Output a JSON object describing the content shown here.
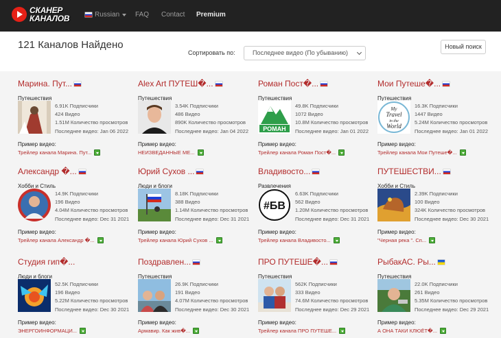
{
  "nav": {
    "logo_line1": "СКАНЕР",
    "logo_line2": "КАНАЛОВ",
    "language": "Russian",
    "faq": "FAQ",
    "contact": "Contact",
    "premium": "Premium"
  },
  "heading": "121 Каналов Найдено",
  "sort": {
    "label": "Сортировать по:",
    "value": "Последнее видео (По убыванию)"
  },
  "new_search": "Новый поиск",
  "example_label": "Пример видео:",
  "channels": [
    {
      "title": "Марина. Пут...",
      "flag": "ru",
      "category": "Путешествия",
      "subscribers": "6.91K Подписчики",
      "videos": "424 Видео",
      "views": "1.51M Количество просмотров",
      "last_video": "Последнее видео: Jan 06 2022",
      "example": "Трейлер канала Марина. Пут..."
    },
    {
      "title": "Alex Art ПУТЕШ�...",
      "flag": "ru",
      "category": "Путешествия",
      "subscribers": "3.54K Подписчики",
      "videos": "486 Видео",
      "views": "890K Количество просмотров",
      "last_video": "Последнее видео: Jan 04 2022",
      "example": "НЕИЗВЕДАННЫЕ МЕ..."
    },
    {
      "title": "Роман Пост�...",
      "flag": "ru",
      "category": "Путешествия",
      "subscribers": "49.8K Подписчики",
      "videos": "1072 Видео",
      "views": "10.8M Количество просмотров",
      "last_video": "Последнее видео: Jan 01 2022",
      "example": "Трейлер канала Роман Пост�..."
    },
    {
      "title": "Мои Путеше�...",
      "flag": "ru",
      "category": "Путешествия",
      "subscribers": "16.3K Подписчики",
      "videos": "1447 Видео",
      "views": "5.24M Количество просмотров",
      "last_video": "Последнее видео: Jan 01 2022",
      "example": "Трейлер канала Мои Путеше�..."
    },
    {
      "title": "Александр �...",
      "flag": "ru",
      "category": "Хобби и Стиль",
      "subscribers": "14.9K Подписчики",
      "videos": "196 Видео",
      "views": "4.04M Количество просмотров",
      "last_video": "Последнее видео: Dec 31 2021",
      "example": "Трейлер канала Александр �..."
    },
    {
      "title": "Юрий Сухов ...",
      "flag": "ru",
      "category": "Люди и блоги",
      "subscribers": "8.18K Подписчики",
      "videos": "388 Видео",
      "views": "1.14M Количество просмотров",
      "last_video": "Последнее видео: Dec 31 2021",
      "example": "Трейлер канала Юрий Сухов ..."
    },
    {
      "title": "Владивосто...",
      "flag": "ru",
      "category": "Развлечения",
      "subscribers": "6.63K Подписчики",
      "videos": "562 Видео",
      "views": "1.20M Количество просмотров",
      "last_video": "Последнее видео: Dec 31 2021",
      "example": "Трейлер канала Владивосто..."
    },
    {
      "title": "ПУТЕШЕСТВИ...",
      "flag": "ru",
      "category": "Хобби и Стиль",
      "subscribers": "2.39K Подписчики",
      "videos": "100 Видео",
      "views": "324K Количество просмотров",
      "last_video": "Последнее видео: Dec 30 2021",
      "example": "\"Черная река \". Сп..."
    },
    {
      "title": "Студия гип�...",
      "flag": "",
      "category": "Люди и блоги",
      "subscribers": "52.5K Подписчики",
      "videos": "196 Видео",
      "views": "5.22M Количество просмотров",
      "last_video": "Последнее видео: Dec 30 2021",
      "example": "ЭНЕРГОИНФОРМАЦИ..."
    },
    {
      "title": "Поздравлен...",
      "flag": "ru",
      "category": "Путешествия",
      "subscribers": "26.9K Подписчики",
      "videos": "191 Видео",
      "views": "4.07M Количество просмотров",
      "last_video": "Последнее видео: Dec 30 2021",
      "example": "Армавир. Как жив�..."
    },
    {
      "title": "ПРО ПУТЕШЕ�...",
      "flag": "ru",
      "category": "Путешествия",
      "subscribers": "562K Подписчики",
      "videos": "333 Видео",
      "views": "74.6M Количество просмотров",
      "last_video": "Последнее видео: Dec 29 2021",
      "example": "Трейлер канала ПРО ПУТЕШЕ..."
    },
    {
      "title": "РыбакАС. Ры...",
      "flag": "ua",
      "category": "Путешествия",
      "subscribers": "22.0K Подписчики",
      "videos": "261 Видео",
      "views": "5.35M Количество просмотров",
      "last_video": "Последнее видео: Dec 29 2021",
      "example": "А ОНА ТАКИ КЛЮЁТ�..."
    }
  ],
  "thumb_texts": {
    "roman": "РОМАН",
    "bv": "#БВ",
    "travel_line1": "My",
    "travel_line2": "Travel",
    "travel_line3": "in the",
    "travel_line4": "World"
  }
}
